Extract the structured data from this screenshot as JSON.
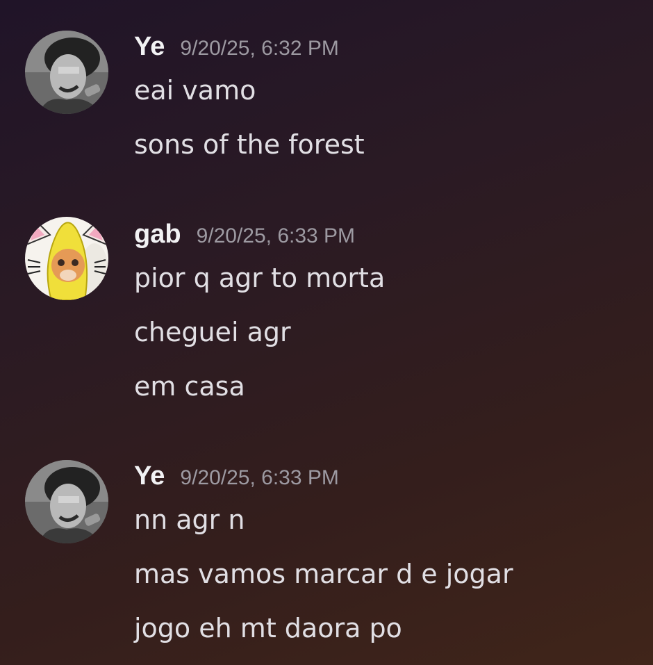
{
  "messages": [
    {
      "author": "Ye",
      "timestamp": "9/20/25, 6:32 PM",
      "avatar": "ye-avatar-photo",
      "lines": [
        "eai vamo",
        "sons of the forest"
      ]
    },
    {
      "author": "gab",
      "timestamp": "9/20/25, 6:33 PM",
      "avatar": "banana-cat-avatar",
      "lines": [
        "pior q agr to morta",
        "cheguei agr",
        "em casa"
      ]
    },
    {
      "author": "Ye",
      "timestamp": "9/20/25, 6:33 PM",
      "avatar": "ye-avatar-photo",
      "lines": [
        "nn agr n",
        "mas vamos marcar d e jogar",
        "jogo eh mt daora po"
      ]
    }
  ],
  "colors": {
    "username": "#f2f2f4",
    "timestamp": "#9d9aa2",
    "message_text": "#e1dfe4",
    "background_start": "#201428",
    "background_end": "#40251a"
  }
}
